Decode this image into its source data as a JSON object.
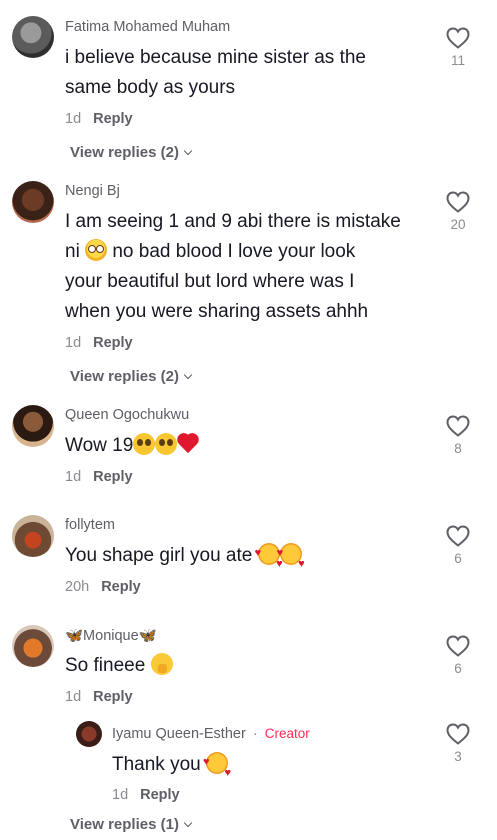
{
  "like_icon": "heart-outline-icon",
  "comments": [
    {
      "username": "Fatima Mohamed Muham",
      "text_lines": [
        "i believe because mine sister as the",
        "same body as yours"
      ],
      "time": "1d",
      "reply_label": "Reply",
      "likes": "11",
      "view_replies": "View replies (2)"
    },
    {
      "username": "Nengi Bj",
      "text_lines": [
        "I am seeing 1 and 9 abi there is mistake",
        "ni",
        "no bad blood I love your look",
        "your beautiful but lord where was I",
        "when you were sharing assets ahhh"
      ],
      "time": "1d",
      "reply_label": "Reply",
      "likes": "20",
      "view_replies": "View replies (2)"
    },
    {
      "username": "Queen Ogochukwu",
      "text": "Wow 19",
      "time": "1d",
      "reply_label": "Reply",
      "likes": "8"
    },
    {
      "username": "follytem",
      "text": "You shape girl you ate",
      "time": "20h",
      "reply_label": "Reply",
      "likes": "6"
    },
    {
      "username": "🦋Monique🦋",
      "text": "So fineee",
      "time": "1d",
      "reply_label": "Reply",
      "likes": "6"
    }
  ],
  "reply": {
    "username": "Iyamu Queen-Esther",
    "badge_sep": "·",
    "badge": "Creator",
    "text": "Thank you",
    "time": "1d",
    "reply_label": "Reply",
    "likes": "3"
  },
  "bottom_view_replies": "View replies (1)",
  "colors": {
    "creator_badge": "#fe2c55",
    "text": "#161823",
    "muted": "#8a8b91"
  }
}
